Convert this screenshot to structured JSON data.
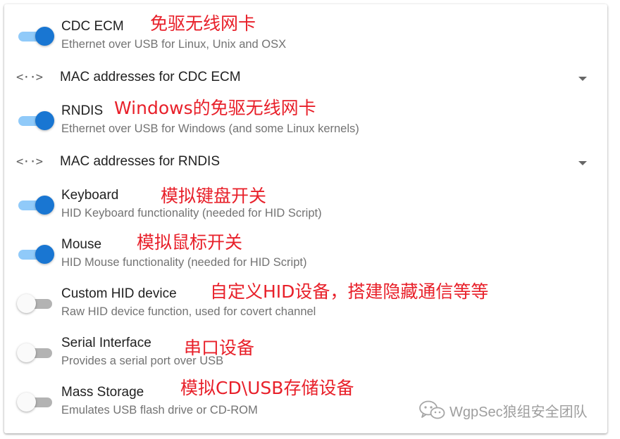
{
  "settings": {
    "cdc_ecm": {
      "title": "CDC ECM",
      "subtitle": "Ethernet over USB for Linux, Unix and OSX",
      "enabled": true,
      "note": "免驱无线网卡"
    },
    "cdc_ecm_mac": {
      "label": "MAC addresses for CDC ECM"
    },
    "rndis": {
      "title": "RNDIS",
      "subtitle": "Ethernet over USB for Windows (and some Linux kernels)",
      "enabled": true,
      "note": "Windows的免驱无线网卡"
    },
    "rndis_mac": {
      "label": "MAC addresses for RNDIS"
    },
    "keyboard": {
      "title": "Keyboard",
      "subtitle": "HID Keyboard functionality (needed for HID Script)",
      "enabled": true,
      "note": "模拟键盘开关"
    },
    "mouse": {
      "title": "Mouse",
      "subtitle": "HID Mouse functionality (needed for HID Script)",
      "enabled": true,
      "note": "模拟鼠标开关"
    },
    "custom_hid": {
      "title": "Custom HID device",
      "subtitle": "Raw HID device function, used for covert channel",
      "enabled": false,
      "note": "自定义HID设备，搭建隐藏通信等等"
    },
    "serial": {
      "title": "Serial Interface",
      "subtitle": "Provides a serial port over USB",
      "enabled": false,
      "note": "串口设备"
    },
    "mass_storage": {
      "title": "Mass Storage",
      "subtitle": "Emulates USB flash drive or CD-ROM",
      "enabled": false,
      "note": "模拟CD\\USB存储设备"
    }
  },
  "watermark": {
    "text": "WgpSec狼组安全团队"
  },
  "colors": {
    "accent": "#1976d2",
    "accent_track": "#90caf9",
    "annotation": "#e8202a"
  },
  "icons": {
    "select_icon": "code-brackets-icon",
    "dropdown_icon": "arrow-drop-down-icon"
  }
}
